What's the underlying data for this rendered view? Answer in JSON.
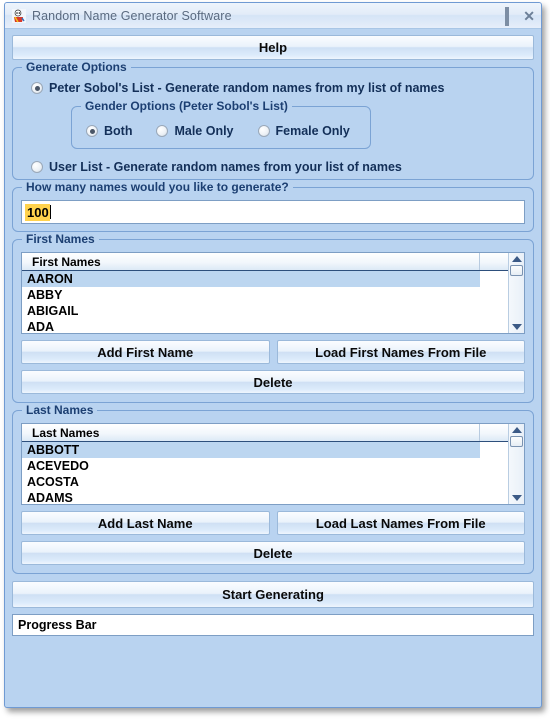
{
  "window": {
    "title": "Random Name Generator Software",
    "icon": "app-icon",
    "controls": {
      "minimize": "minimize",
      "maximize": "maximize",
      "close": "close"
    }
  },
  "help_button": {
    "label": "Help"
  },
  "generate_options": {
    "legend": "Generate Options",
    "options": [
      {
        "label": "Peter Sobol's List - Generate random names from my list of names",
        "selected": true
      },
      {
        "label": "User List - Generate random names from your list of names",
        "selected": false
      }
    ],
    "gender_options": {
      "legend": "Gender Options (Peter Sobol's List)",
      "options": [
        {
          "label": "Both",
          "selected": true
        },
        {
          "label": "Male Only",
          "selected": false
        },
        {
          "label": "Female Only",
          "selected": false
        }
      ]
    }
  },
  "count_section": {
    "legend": "How many names would you like to generate?",
    "value": "100",
    "placeholder": ""
  },
  "first_names": {
    "legend": "First Names",
    "column_header": "First Names",
    "rows": [
      "AARON",
      "ABBY",
      "ABIGAIL",
      "ADA"
    ],
    "selected_index": 0,
    "buttons": {
      "add": "Add First Name",
      "load": "Load First Names From File",
      "delete": "Delete"
    }
  },
  "last_names": {
    "legend": "Last Names",
    "column_header": "Last Names",
    "rows": [
      "ABBOTT",
      "ACEVEDO",
      "ACOSTA",
      "ADAMS"
    ],
    "selected_index": 0,
    "buttons": {
      "add": "Add Last Name",
      "load": "Load Last Names From File",
      "delete": "Delete"
    }
  },
  "start_button": {
    "label": "Start Generating"
  },
  "progress_bar": {
    "label": "Progress Bar"
  },
  "colors": {
    "window_bg": "#b9d3f0",
    "group_border": "#7ba3d4",
    "legend_text": "#1c3f72",
    "selection_blue": "#bcd6f0",
    "selection_yellow": "#ffd24d"
  }
}
